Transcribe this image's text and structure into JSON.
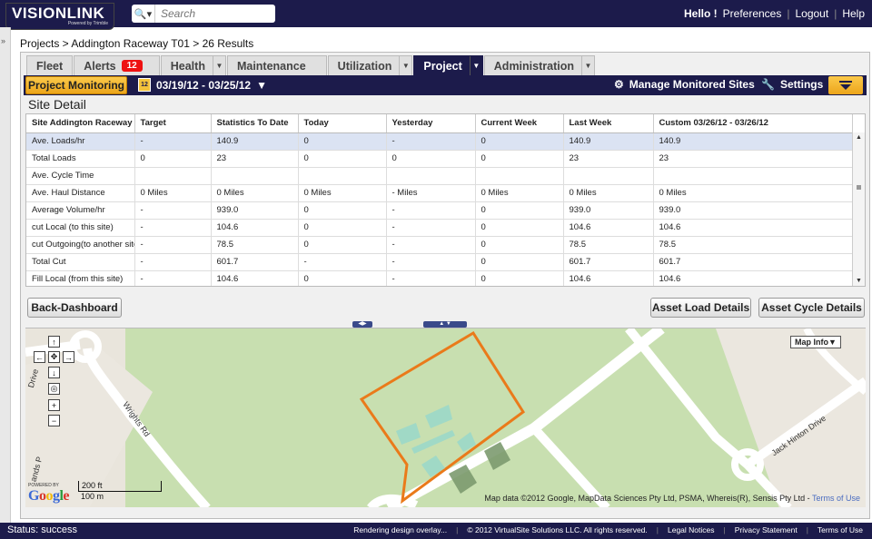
{
  "topbar": {
    "logo": "VISIONLINK",
    "logo_sub": "Powered by Trimble",
    "search_placeholder": "Search",
    "hello": "Hello !",
    "links": [
      "Preferences",
      "Logout",
      "Help"
    ]
  },
  "breadcrumb": "Projects > Addington Raceway T01 > 26 Results",
  "tabs": [
    {
      "label": "Fleet"
    },
    {
      "label": "Alerts",
      "badge": "12"
    },
    {
      "label": "Health"
    },
    {
      "label": "Maintenance"
    },
    {
      "label": "Utilization"
    },
    {
      "label": "Project"
    },
    {
      "label": "Administration"
    }
  ],
  "subbar": {
    "project_monitoring": "Project Monitoring",
    "calendar_icon_text": "12",
    "date_range": "03/19/12 - 03/25/12",
    "manage_sites": "Manage Monitored Sites",
    "settings": "Settings"
  },
  "section_title": "Site Detail",
  "table": {
    "headers": [
      "Site Addington Raceway",
      "Target",
      "Statistics To Date",
      "Today",
      "Yesterday",
      "Current Week",
      "Last Week",
      "Custom    03/26/12 - 03/26/12"
    ],
    "rows": [
      [
        "Ave. Loads/hr",
        "-",
        "140.9",
        "0",
        "-",
        "0",
        "140.9",
        "140.9"
      ],
      [
        "Total Loads",
        "0",
        "23",
        "0",
        "0",
        "0",
        "23",
        "23"
      ],
      [
        "Ave. Cycle Time",
        "",
        "",
        "",
        "",
        "",
        "",
        ""
      ],
      [
        "Ave. Haul Distance",
        "0 Miles",
        "0 Miles",
        "0 Miles",
        "- Miles",
        "0 Miles",
        "0 Miles",
        "0 Miles"
      ],
      [
        "Average Volume/hr",
        "-",
        "939.0",
        "0",
        "-",
        "0",
        "939.0",
        "939.0"
      ],
      [
        "cut Local (to this site)",
        "-",
        "104.6",
        "0",
        "-",
        "0",
        "104.6",
        "104.6"
      ],
      [
        "cut Outgoing(to another site)",
        "-",
        "78.5",
        "0",
        "-",
        "0",
        "78.5",
        "78.5"
      ],
      [
        "Total Cut",
        "-",
        "601.7",
        "-",
        "-",
        "0",
        "601.7",
        "601.7"
      ],
      [
        "Fill Local (from this site)",
        "-",
        "104.6",
        "0",
        "-",
        "0",
        "104.6",
        "104.6"
      ]
    ]
  },
  "buttons": {
    "back": "Back-Dashboard",
    "asset_load": "Asset Load Details",
    "asset_cycle": "Asset Cycle Details"
  },
  "map": {
    "map_info": "Map Info",
    "roads": [
      "Wrights Rd",
      "Jack Hinton Drive",
      "Drive",
      "ands P"
    ],
    "scale_ft": "200 ft",
    "scale_m": "100 m",
    "powered_by": "POWERED BY",
    "google": "Google",
    "attribution": "Map data ©2012  Google, MapData Sciences Pty Ltd, PSMA, Whereis(R), Sensis Pty Ltd - ",
    "terms": "Terms of Use"
  },
  "statusbar": {
    "status": "Status: success",
    "rendering": "Rendering design overlay...",
    "copyright": "© 2012 VirtualSite Solutions LLC. All rights reserved.",
    "legal": "Legal Notices",
    "privacy": "Privacy Statement",
    "terms": "Terms of Use"
  }
}
